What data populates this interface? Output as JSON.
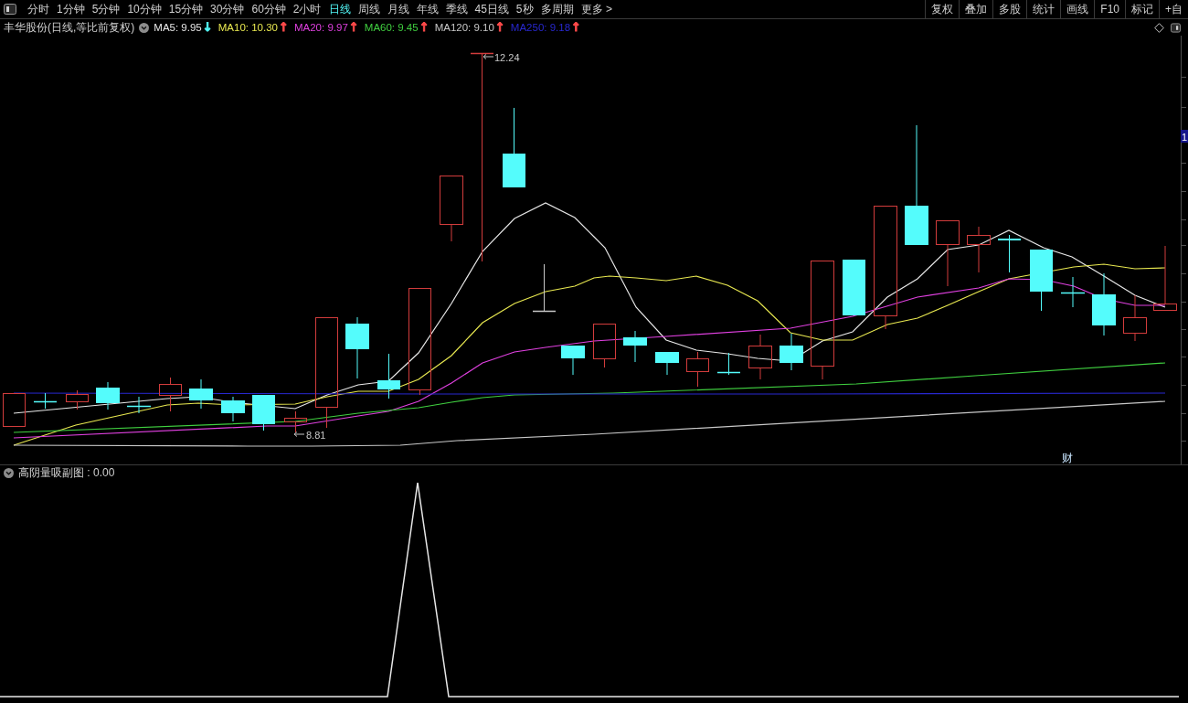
{
  "toolbar": {
    "tabs": [
      {
        "label": "分时",
        "selected": false
      },
      {
        "label": "1分钟",
        "selected": false
      },
      {
        "label": "5分钟",
        "selected": false
      },
      {
        "label": "10分钟",
        "selected": false
      },
      {
        "label": "15分钟",
        "selected": false
      },
      {
        "label": "30分钟",
        "selected": false
      },
      {
        "label": "60分钟",
        "selected": false
      },
      {
        "label": "2小时",
        "selected": false
      },
      {
        "label": "日线",
        "selected": true
      },
      {
        "label": "周线",
        "selected": false
      },
      {
        "label": "月线",
        "selected": false
      },
      {
        "label": "年线",
        "selected": false
      },
      {
        "label": "季线",
        "selected": false
      },
      {
        "label": "45日线",
        "selected": false
      },
      {
        "label": "5秒",
        "selected": false
      },
      {
        "label": "多周期",
        "selected": false
      },
      {
        "label": "更多 >",
        "selected": false
      }
    ],
    "buttons": [
      "复权",
      "叠加",
      "多股",
      "统计",
      "画线",
      "F10",
      "标记",
      "+自"
    ]
  },
  "chart": {
    "title": "丰华股份(日线,等比前复权)",
    "ma_legend": [
      {
        "label": "MA5: 9.95",
        "color": "#e8e8e8",
        "arrow": {
          "text": "↓",
          "color": "#54fcfc"
        }
      },
      {
        "label": "MA10: 10.30",
        "color": "#e8e850",
        "arrow": {
          "text": "↑",
          "color": "#ff4a4a"
        }
      },
      {
        "label": "MA20: 9.97",
        "color": "#e040e0",
        "arrow": {
          "text": "↑",
          "color": "#ff4a4a"
        }
      },
      {
        "label": "MA60: 9.45",
        "color": "#40d040",
        "arrow": {
          "text": "↑",
          "color": "#ff4a4a"
        }
      },
      {
        "label": "MA120: 9.10",
        "color": "#c8c8c8",
        "arrow": {
          "text": "↑",
          "color": "#ff4a4a"
        }
      },
      {
        "label": "MA250: 9.18",
        "color": "#2828d0",
        "arrow": {
          "text": "↑",
          "color": "#ff4a4a"
        }
      }
    ],
    "high_label": "12.24",
    "low_label": "8.81",
    "event_marker": "财",
    "axis_label": "1"
  },
  "indicator": {
    "title": "高阴量吸副图 : 0.00"
  }
}
